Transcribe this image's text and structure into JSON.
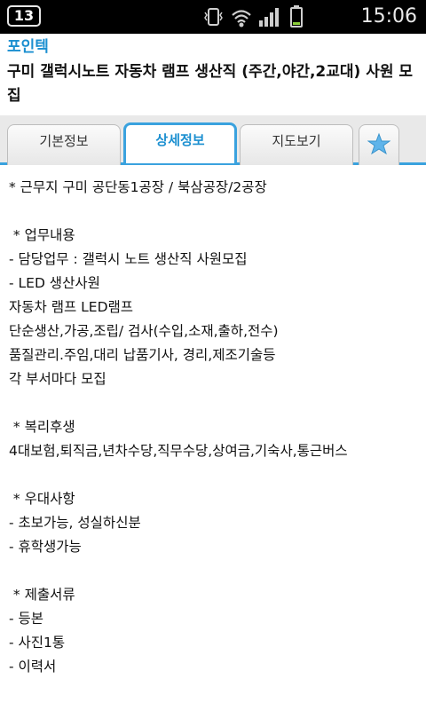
{
  "status_bar": {
    "notification_count": "13",
    "time": "15:06",
    "icons": [
      "vibrate-icon",
      "wifi-icon",
      "signal-icon",
      "battery-icon"
    ]
  },
  "header": {
    "app_name": "포인텍",
    "job_title": "구미 갤럭시노트 자동차 램프 생산직 (주간,야간,2교대) 사원 모집"
  },
  "tabs": [
    {
      "label": "기본정보",
      "active": false
    },
    {
      "label": "상세정보",
      "active": true
    },
    {
      "label": "지도보기",
      "active": false
    }
  ],
  "favorite_icon": "star-icon",
  "content_lines": [
    "* 근무지 구미 공단동1공장 / 북삼공장/2공장",
    "",
    " * 업무내용",
    "- 담당업무 : 갤럭시 노트 생산직 사원모집",
    "- LED 생산사원",
    "자동차 램프 LED램프",
    "단순생산,가공,조립/ 검사(수입,소재,출하,전수)",
    "품질관리.주임,대리 납품기사, 경리,제조기술등",
    "각 부서마다 모집",
    "",
    " * 복리후생",
    "4대보험,퇴직금,년차수당,직무수당,상여금,기숙사,통근버스",
    "",
    " * 우대사항",
    "- 초보가능, 성실하신분",
    "- 휴학생가능",
    "",
    " * 제출서류",
    "- 등본",
    "- 사진1통",
    "- 이력서"
  ],
  "colors": {
    "accent": "#1b8fd0",
    "tab_border": "#3aa2de",
    "tabbar_bg": "#e9e9e9",
    "status_bar_bg": "#000000"
  }
}
